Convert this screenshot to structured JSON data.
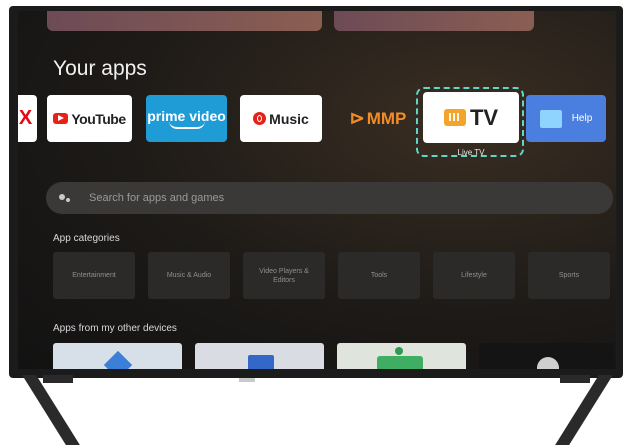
{
  "header": {
    "title": "Your apps"
  },
  "apps": [
    {
      "name": "netflix",
      "label": "X"
    },
    {
      "name": "youtube",
      "label": "YouTube"
    },
    {
      "name": "prime-video",
      "label": "prime video"
    },
    {
      "name": "music",
      "label": "Music"
    },
    {
      "name": "mmp",
      "label": "MMP"
    },
    {
      "name": "live-tv",
      "label": "TV"
    },
    {
      "name": "help",
      "label": "Help"
    }
  ],
  "focused_app_label": "Live TV",
  "search": {
    "placeholder": "Search for apps and games"
  },
  "categories_title": "App categories",
  "categories": [
    "Entertainment",
    "Music & Audio",
    "Video Players & Editors",
    "Tools",
    "Lifestyle",
    "Sports"
  ],
  "devices_title": "Apps from my other devices",
  "colors": {
    "focus": "#5fd6c9",
    "accent_red": "#e62117",
    "prime_blue": "#1f9bd6",
    "help_blue": "#4a7fe0"
  },
  "icons": [
    "youtube-logo-icon",
    "music-logo-icon",
    "mmp-logo-icon",
    "tv-logo-icon",
    "help-book-icon",
    "assistant-icon"
  ]
}
